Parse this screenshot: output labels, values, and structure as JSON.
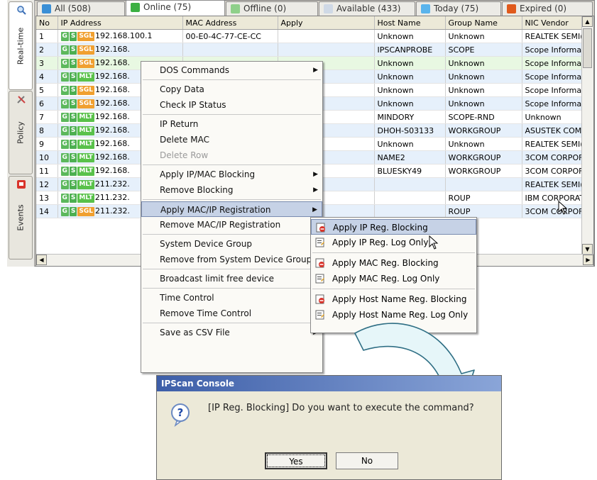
{
  "sidebar": {
    "tabs": [
      {
        "label": "Real-time",
        "icon": "search-icon"
      },
      {
        "label": "Policy",
        "icon": "tools-icon"
      },
      {
        "label": "Events",
        "icon": "alert-icon"
      }
    ]
  },
  "tabs": [
    {
      "label": "All (508)",
      "icon": "all-icon",
      "color": "#3a8fd6"
    },
    {
      "label": "Online (75)",
      "icon": "online-icon",
      "color": "#3cb043"
    },
    {
      "label": "Offline (0)",
      "icon": "offline-icon",
      "color": "#8fd08a"
    },
    {
      "label": "Available (433)",
      "icon": "available-icon",
      "color": "#cfd9e6"
    },
    {
      "label": "Today (75)",
      "icon": "today-icon",
      "color": "#5ab4ec"
    },
    {
      "label": "Expired (0)",
      "icon": "expired-icon",
      "color": "#e05a1c"
    }
  ],
  "table": {
    "columns": [
      "No",
      "IP Address",
      "MAC Address",
      "Apply",
      "Host Name",
      "Group Name",
      "NIC Vendor"
    ],
    "rows": [
      {
        "no": "1",
        "badges": [
          "G",
          "S",
          "SGL"
        ],
        "ip": "192.168.100.1",
        "mac": "00-E0-4C-77-CE-CC",
        "host": "Unknown",
        "group": "Unknown",
        "vendor": "REALTEK SEMI("
      },
      {
        "no": "2",
        "badges": [
          "G",
          "S",
          "SGL"
        ],
        "ip": "192.168.",
        "mac": "",
        "host": "IPSCANPROBE",
        "group": "SCOPE",
        "vendor": "Scope Informat"
      },
      {
        "no": "3",
        "badges": [
          "G",
          "S",
          "SGL"
        ],
        "ip": "192.168.",
        "mac": "",
        "host": "Unknown",
        "group": "Unknown",
        "vendor": "Scope Informat"
      },
      {
        "no": "4",
        "badges": [
          "G",
          "S",
          "MLT"
        ],
        "ip": "192.168.",
        "mac": "",
        "host": "Unknown",
        "group": "Unknown",
        "vendor": "Scope Informat"
      },
      {
        "no": "5",
        "badges": [
          "G",
          "S",
          "SGL"
        ],
        "ip": "192.168.",
        "mac": "",
        "host": "Unknown",
        "group": "Unknown",
        "vendor": "Scope Informat"
      },
      {
        "no": "6",
        "badges": [
          "G",
          "S",
          "SGL"
        ],
        "ip": "192.168.",
        "mac": "",
        "host": "Unknown",
        "group": "Unknown",
        "vendor": "Scope Informat"
      },
      {
        "no": "7",
        "badges": [
          "G",
          "S",
          "MLT"
        ],
        "ip": "192.168.",
        "mac": "",
        "host": "MINDORY",
        "group": "SCOPE-RND",
        "vendor": "Unknown"
      },
      {
        "no": "8",
        "badges": [
          "G",
          "S",
          "MLT"
        ],
        "ip": "192.168.",
        "mac": "",
        "host": "DHOH-S03133",
        "group": "WORKGROUP",
        "vendor": "ASUSTEK COMF"
      },
      {
        "no": "9",
        "badges": [
          "G",
          "S",
          "MLT"
        ],
        "ip": "192.168.",
        "mac": "",
        "host": "Unknown",
        "group": "Unknown",
        "vendor": "REALTEK SEMI("
      },
      {
        "no": "10",
        "badges": [
          "G",
          "S",
          "MLT"
        ],
        "ip": "192.168.",
        "mac": "",
        "host": "NAME2",
        "group": "WORKGROUP",
        "vendor": "3COM CORPOF"
      },
      {
        "no": "11",
        "badges": [
          "G",
          "S",
          "MLT"
        ],
        "ip": "192.168.",
        "mac": "",
        "host": "BLUESKY49",
        "group": "WORKGROUP",
        "vendor": "3COM CORPOF"
      },
      {
        "no": "12",
        "badges": [
          "G",
          "S",
          "MLT"
        ],
        "ip": "211.232.",
        "mac": "",
        "host": "",
        "group": "",
        "vendor": "REALTEK SEMI("
      },
      {
        "no": "13",
        "badges": [
          "G",
          "S",
          "MLT"
        ],
        "ip": "211.232.",
        "mac": "",
        "host": "",
        "group": "ROUP",
        "vendor": "IBM CORPORAT"
      },
      {
        "no": "14",
        "badges": [
          "G",
          "S",
          "SGL"
        ],
        "ip": "211.232.",
        "mac": "",
        "host": "",
        "group": "ROUP",
        "vendor": "3COM CORPOF"
      }
    ]
  },
  "context_menu": {
    "items": [
      {
        "label": "DOS Commands",
        "submenu": true,
        "disabled": false,
        "highlighted": false
      },
      {
        "label": "Copy Data",
        "submenu": false,
        "disabled": false,
        "highlighted": false
      },
      {
        "label": "Check IP Status",
        "submenu": false,
        "disabled": false,
        "highlighted": false
      },
      {
        "label": "IP Return",
        "submenu": false,
        "disabled": false,
        "highlighted": false
      },
      {
        "label": "Delete MAC",
        "submenu": false,
        "disabled": false,
        "highlighted": false
      },
      {
        "label": "Delete Row",
        "submenu": false,
        "disabled": true,
        "highlighted": false
      },
      {
        "label": "Apply IP/MAC Blocking",
        "submenu": true,
        "disabled": false,
        "highlighted": false
      },
      {
        "label": "Remove Blocking",
        "submenu": true,
        "disabled": false,
        "highlighted": false
      },
      {
        "label": "Apply MAC/IP Registration",
        "submenu": true,
        "disabled": false,
        "highlighted": true
      },
      {
        "label": "Remove MAC/IP Registration",
        "submenu": false,
        "disabled": false,
        "highlighted": false
      },
      {
        "label": "System Device Group",
        "submenu": false,
        "disabled": false,
        "highlighted": false
      },
      {
        "label": "Remove from System Device Group",
        "submenu": false,
        "disabled": false,
        "highlighted": false
      },
      {
        "label": "Broadcast limit free device",
        "submenu": false,
        "disabled": false,
        "highlighted": false
      },
      {
        "label": "Time Control",
        "submenu": false,
        "disabled": false,
        "highlighted": false
      },
      {
        "label": "Remove Time Control",
        "submenu": true,
        "disabled": false,
        "highlighted": false
      },
      {
        "label": "Save as CSV File",
        "submenu": true,
        "disabled": false,
        "highlighted": false
      }
    ]
  },
  "submenu": {
    "items": [
      {
        "label": "Apply IP Reg. Blocking",
        "icon": "block-icon",
        "highlighted": true
      },
      {
        "label": "Apply IP Reg. Log Only",
        "icon": "log-icon",
        "highlighted": false
      },
      {
        "label": "Apply MAC Reg. Blocking",
        "icon": "block-icon",
        "highlighted": false
      },
      {
        "label": "Apply  MAC Reg. Log Only",
        "icon": "log-icon",
        "highlighted": false
      },
      {
        "label": "Apply Host Name Reg. Blocking",
        "icon": "block-icon",
        "highlighted": false
      },
      {
        "label": "Apply Host Name Reg. Log Only",
        "icon": "log-icon",
        "highlighted": false
      }
    ]
  },
  "dialog": {
    "title": "IPScan Console",
    "message": "[IP Reg. Blocking]  Do you want to execute the command?",
    "yes_label": "Yes",
    "no_label": "No",
    "icon": "question-icon"
  }
}
